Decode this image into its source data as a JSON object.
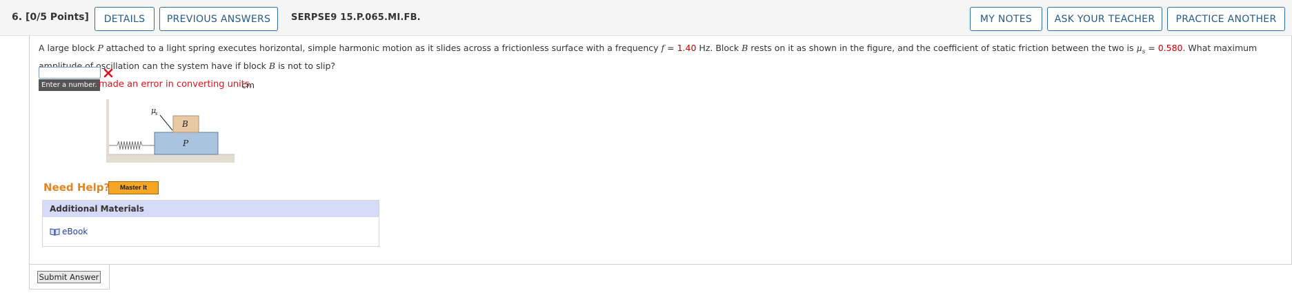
{
  "header": {
    "question_number": "6.",
    "points": "[0/5 Points]",
    "details_label": "DETAILS",
    "previous_answers_label": "PREVIOUS ANSWERS",
    "question_id": "SERPSE9 15.P.065.MI.FB.",
    "my_notes_label": "MY NOTES",
    "ask_teacher_label": "ASK YOUR TEACHER",
    "practice_another_label": "PRACTICE ANOTHER"
  },
  "question": {
    "p1": "A large block ",
    "var_p": "P",
    "p2": " attached to a light spring executes horizontal, simple harmonic motion as it slides across a frictionless surface with a frequency ",
    "var_f": "f",
    "p3": " = ",
    "frequency_value": "1.40",
    "p4": " Hz. Block ",
    "var_b": "B",
    "p5": " rests on it as shown in the figure, and the coefficient of static friction between the two is ",
    "var_mu": "μ",
    "var_s": "s",
    "p6": " = ",
    "mu_value": "0.580",
    "p7": ". What maximum amplitude of oscillation can the system have if block ",
    "var_b2": "B",
    "p8": " is not to slip?"
  },
  "answer": {
    "value": "",
    "tooltip": "Enter a number.",
    "error_message": "made an error in converting units.",
    "unit": "cm"
  },
  "figure": {
    "label_mu": "μ",
    "label_s": "s",
    "label_b": "B",
    "label_p": "P",
    "block_b_color": "#e9c9a4",
    "block_p_color": "#aac3df",
    "floor_color": "#e2dcd2"
  },
  "help": {
    "need_help_label": "Need Help?",
    "master_it_label": "Master It"
  },
  "additional_materials": {
    "title": "Additional Materials",
    "ebook_label": "eBook"
  },
  "submit": {
    "label": "Submit Answer"
  },
  "colors": {
    "accent": "#245b8a",
    "error": "#e0101a",
    "highlight_value": "#c00000",
    "need_help": "#e48522"
  }
}
